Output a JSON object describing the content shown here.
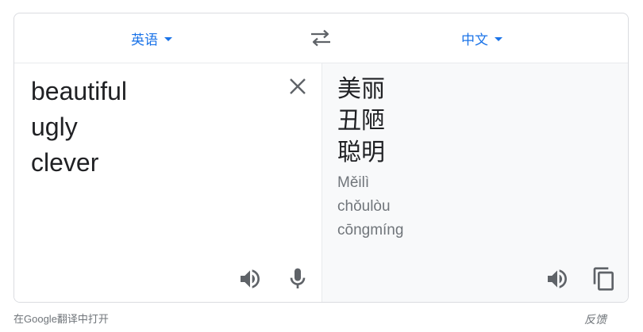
{
  "header": {
    "source_language": "英语",
    "target_language": "中文"
  },
  "source": {
    "lines": [
      "beautiful",
      "ugly",
      "clever"
    ]
  },
  "translation": {
    "lines": [
      "美丽",
      "丑陋",
      "聪明"
    ],
    "romanization": [
      "Měilì",
      "chǒulòu",
      "cōngmíng"
    ]
  },
  "icons": {
    "caret": "caret-down-icon",
    "swap": "swap-languages-icon",
    "clear": "close-icon",
    "listen": "speaker-icon",
    "mic": "microphone-icon",
    "copy": "copy-icon"
  },
  "footer": {
    "open_link": "在Google翻译中打开",
    "feedback": "反馈"
  },
  "colors": {
    "accent": "#1a73e8",
    "icon": "#5f6368",
    "muted_text": "#70757a",
    "target_pane_bg": "#f8f9fa"
  }
}
